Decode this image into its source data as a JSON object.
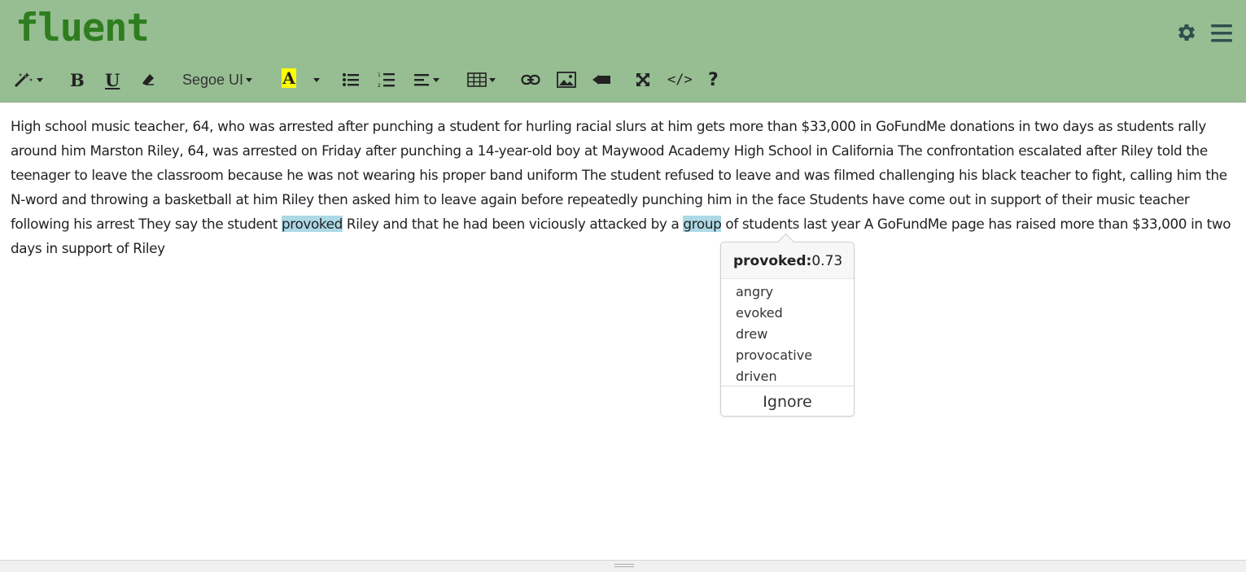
{
  "app": {
    "logo": "fluent"
  },
  "toolbar": {
    "font_label": "Segoe UI",
    "bold_label": "B",
    "underline_label": "U",
    "color_label": "A",
    "help_label": "?",
    "code_label": "</>",
    "highlight_color": "#ffff00"
  },
  "editor": {
    "text_before": "High school music teacher, 64, who was arrested after punching a student for hurling racial slurs at him gets more than $33,000 in GoFundMe donations in two days as students rally around him Marston Riley, 64, was arrested on Friday after punching a 14-year-old boy at Maywood Academy High School in California The confrontation escalated after Riley told the teenager to leave the classroom because he was not wearing his proper band uniform The student refused to leave and was filmed challenging his black teacher to fight, calling him the N-word and throwing a basketball at him Riley then asked him to leave again before repeatedly punching him in the face Students have come out in support of their music teacher following his arrest They say the student ",
    "highlight_1": "provoked",
    "text_middle": " Riley and that he had been viciously attacked by a ",
    "highlight_2": "group",
    "text_after": " of students last year A GoFundMe page has raised more than $33,000 in two days in support of Riley"
  },
  "popup": {
    "word": "provoked:",
    "score": "0.73",
    "suggestions": [
      "angry",
      "evoked",
      "drew",
      "provocative",
      "driven"
    ],
    "ignore_label": "Ignore"
  },
  "colors": {
    "header_bg": "#97bd93",
    "logo": "#2e7d1e",
    "highlight": "#add8e6"
  }
}
